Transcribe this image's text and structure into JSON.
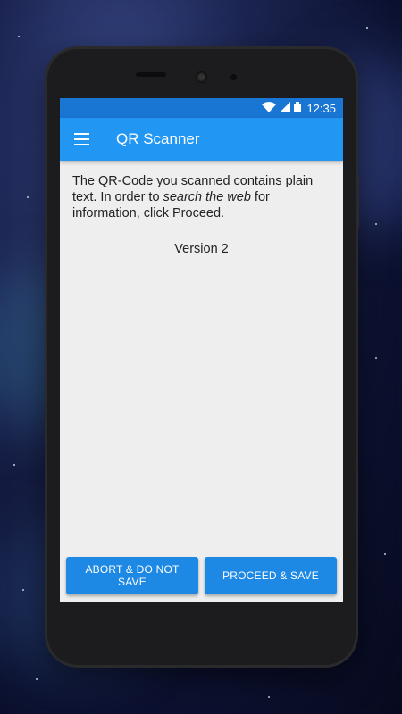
{
  "status_bar": {
    "time": "12:35"
  },
  "app_bar": {
    "title": "QR Scanner",
    "menu_icon": "menu-icon"
  },
  "message": {
    "part1": "The QR-Code you scanned contains plain text. In order to ",
    "emphasis": "search the web",
    "part2": " for information, click Proceed."
  },
  "version": "Version 2",
  "buttons": {
    "abort_label": "ABORT & DO NOT SAVE",
    "proceed_label": "PROCEED & SAVE"
  },
  "colors": {
    "status_bar": "#1976d2",
    "app_bar": "#2196f3",
    "button": "#1e88e5",
    "screen_bg": "#eeeeee"
  }
}
